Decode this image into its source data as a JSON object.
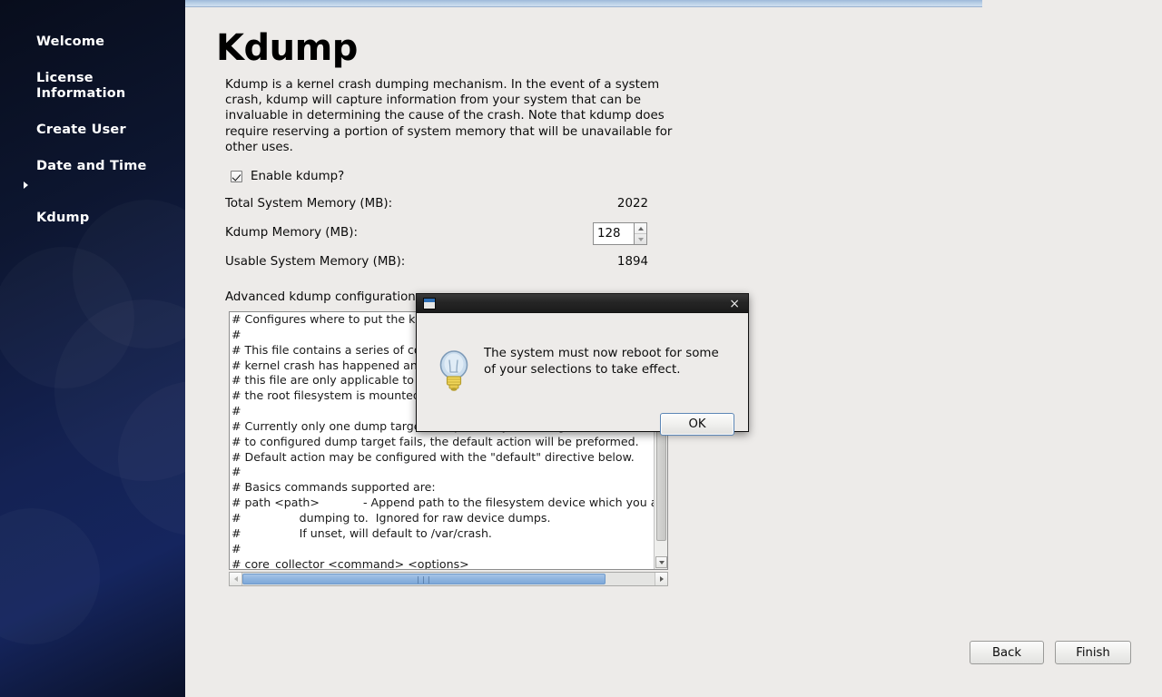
{
  "sidebar": {
    "items": [
      {
        "label": "Welcome",
        "selected": false
      },
      {
        "label": "License\nInformation",
        "selected": false
      },
      {
        "label": "Create User",
        "selected": false
      },
      {
        "label": "Date and Time",
        "selected": false
      },
      {
        "label": "Kdump",
        "selected": true
      }
    ]
  },
  "page": {
    "title": "Kdump",
    "description": "Kdump is a kernel crash dumping mechanism. In the event of a system crash, kdump will capture information from your system that can be invaluable in determining the cause of the crash. Note that kdump does require reserving a portion of system memory that will be unavailable for other uses."
  },
  "form": {
    "enable_label": "Enable kdump?",
    "enable_checked": true,
    "total_memory_label": "Total System Memory (MB):",
    "total_memory_value": "2022",
    "kdump_memory_label": "Kdump Memory (MB):",
    "kdump_memory_value": "128",
    "usable_memory_label": "Usable System Memory (MB):",
    "usable_memory_value": "1894",
    "advanced_label": "Advanced kdump configuration"
  },
  "config_text": "# Configures where to put the kdump /proc/vmcore files\n#\n# This file contains a series of commands to perform (in order) when a\n# kernel crash has happened and the kdump kernel has been loaded.  Directives in\n# this file are only applicable to the kdump initramfs, and have no effect once\n# the root filesystem is mounted and the normal init scripts are processed.\n#\n# Currently only one dump target and path may be configured at once. If the dump\n# to configured dump target fails, the default action will be preformed.\n# Default action may be configured with the \"default\" directive below.\n#\n# Basics commands supported are:\n# path <path>            - Append path to the filesystem device which you are\n#                dumping to.  Ignored for raw device dumps.\n#                If unset, will default to /var/crash.\n#\n# core_collector <command> <options>",
  "scrollbars": {
    "h_grip": "|||"
  },
  "footer": {
    "back_label": "Back",
    "finish_label": "Finish"
  },
  "dialog": {
    "message": "The system must now reboot for some of your selections to take effect.",
    "ok_label": "OK",
    "close_label": "×"
  },
  "colors": {
    "sidebar_dark": "#0d1630",
    "sidebar_blue": "#15255e",
    "background": "#edebe9",
    "accent_blue": "#8fb4df",
    "dialog_titlebar": "#252525"
  }
}
